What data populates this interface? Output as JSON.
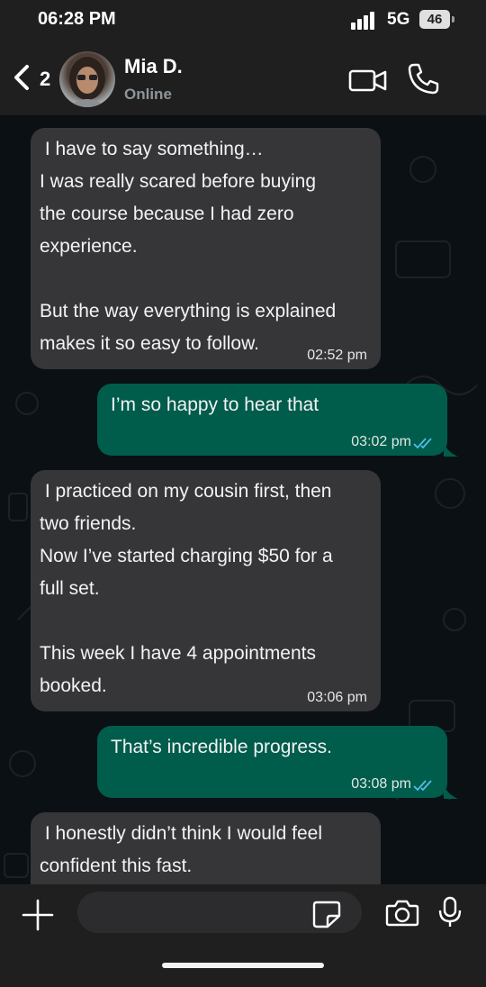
{
  "status_bar": {
    "time": "06:28 PM",
    "network": "5G",
    "battery": "46"
  },
  "header": {
    "back_count": "2",
    "contact_name": "Mia D.",
    "contact_status": "Online"
  },
  "messages": [
    {
      "direction": "in",
      "text": " I have to say something…\nI was really scared before buying\nthe course because I had zero\nexperience.\n\nBut the way everything is explained\nmakes it so easy to follow.",
      "time": "02:52 pm"
    },
    {
      "direction": "out",
      "text": "I’m so happy to hear that",
      "time": "03:02 pm",
      "status": "read"
    },
    {
      "direction": "in",
      "text": " I practiced on my cousin first, then\ntwo friends.\nNow I’ve started charging $50 for a\nfull set.\n\nThis week I have 4 appointments\nbooked.",
      "time": "03:06 pm"
    },
    {
      "direction": "out",
      "text": "That’s incredible progress.",
      "time": "03:08 pm",
      "status": "read"
    },
    {
      "direction": "in",
      "text": " I honestly didn’t think I would feel\nconfident this fast.",
      "time": ""
    }
  ],
  "input": {
    "value": "",
    "placeholder": ""
  },
  "icons": {
    "back": "chevron-left-icon",
    "video": "video-camera-icon",
    "call": "phone-icon",
    "plus": "plus-icon",
    "sticker": "sticker-icon",
    "camera": "camera-icon",
    "mic": "microphone-icon"
  },
  "colors": {
    "incoming_bubble": "#363638",
    "outgoing_bubble": "#005c4b",
    "read_ticks": "#53bdeb"
  }
}
